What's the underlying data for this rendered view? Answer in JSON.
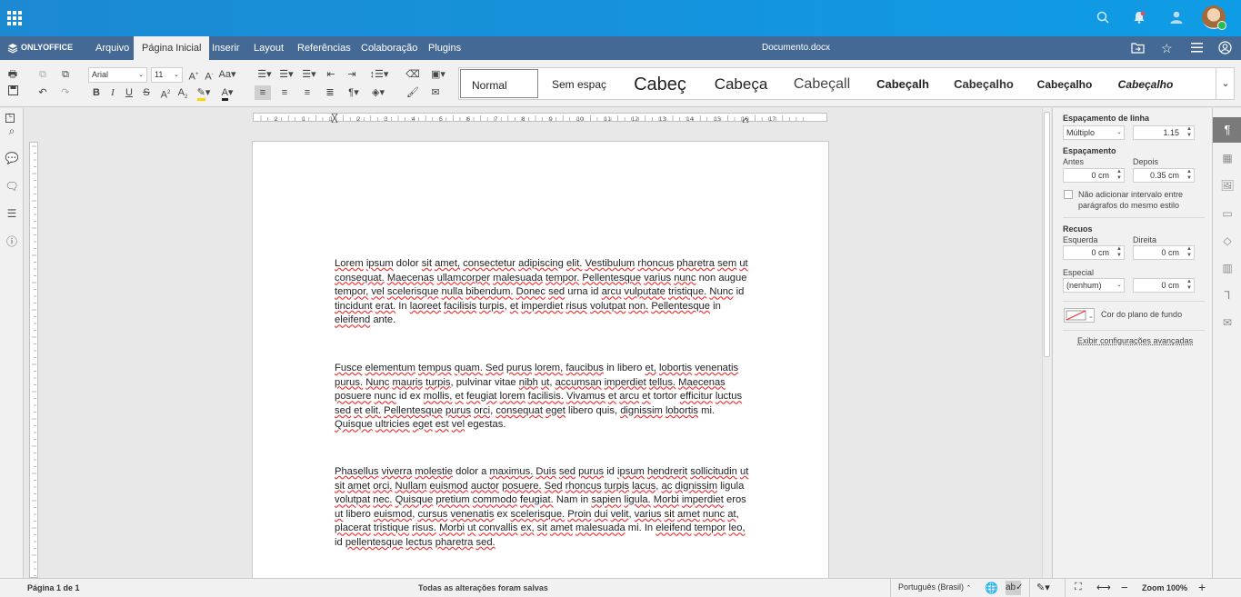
{
  "app": {
    "logo": "ONLYOFFICE",
    "doc_title": "Documento.docx"
  },
  "menu": {
    "items": [
      "Arquivo",
      "Página Inicial",
      "Inserir",
      "Layout",
      "Referências",
      "Colaboração",
      "Plugins"
    ]
  },
  "toolbar": {
    "font_name": "Arial",
    "font_size": "11",
    "styles": [
      "Normal",
      "Sem espaç",
      "Cabeç",
      "Cabeça",
      "Cabeçall",
      "Cabeçalh",
      "Cabeçalho",
      "Cabeçalho",
      "Cabeçalho"
    ]
  },
  "document": {
    "paragraphs": [
      "Lorem ipsum dolor sit amet, consectetur adipiscing elit. Vestibulum rhoncus pharetra sem ut consequat. Maecenas ullamcorper malesuada tempor. Pellentesque varius nunc non augue tempor, vel scelerisque nulla bibendum. Donec sed urna id arcu vulputate tristique. Nunc id tincidunt erat. In laoreet facilisis turpis, et imperdiet risus volutpat non. Pellentesque in eleifend ante.",
      "Fusce elementum tempus quam. Sed purus lorem, faucibus in libero et, lobortis venenatis purus. Nunc mauris turpis, pulvinar vitae nibh ut, accumsan imperdiet tellus. Maecenas posuere nunc id ex mollis, et feugiat lorem facilisis. Vivamus et arcu et tortor efficitur luctus sed et elit. Pellentesque purus orci, consequat eget libero quis, dignissim lobortis mi. Quisque ultricies eget est vel egestas.",
      "Phasellus viverra molestie dolor a maximus. Duis sed purus id ipsum hendrerit sollicitudin ut sit amet orci. Nullam euismod auctor posuere. Sed rhoncus turpis lacus, ac dignissim ligula volutpat nec. Quisque pretium commodo feugiat. Nam in sapien ligula. Morbi imperdiet eros ut libero euismod, cursus venenatis ex scelerisque. Proin dui velit, varius sit amet nunc at, placerat tristique risus. Morbi ut convallis ex, sit amet malesuada mi. In eleifend tempor leo, id pellentesque lectus pharetra sed."
    ]
  },
  "panel": {
    "line_spacing_label": "Espaçamento de linha",
    "line_spacing_mode": "Múltiplo",
    "line_spacing_value": "1.15",
    "spacing_label": "Espaçamento",
    "before_label": "Antes",
    "after_label": "Depois",
    "before_value": "0 cm",
    "after_value": "0.35 cm",
    "no_interval_label": "Não adicionar intervalo entre parágrafos do mesmo estilo",
    "indents_label": "Recuos",
    "left_label": "Esquerda",
    "right_label": "Direita",
    "left_value": "0 cm",
    "right_value": "0 cm",
    "special_label": "Especial",
    "special_value": "(nenhum)",
    "special_amount": "0 cm",
    "bg_color_label": "Cor do plano de fundo",
    "advanced_link": "Exibir configurações avançadas"
  },
  "ruler_numbers": [
    "2",
    "1",
    "1",
    "2",
    "3",
    "4",
    "5",
    "6",
    "7",
    "8",
    "9",
    "10",
    "11",
    "12",
    "13",
    "14",
    "15",
    "16",
    "17"
  ],
  "status": {
    "page": "Página 1 de 1",
    "saved": "Todas as alterações foram salvas",
    "language": "Português (Brasil)",
    "zoom": "Zoom 100%"
  },
  "colors": {
    "topbar": "#1a8cd8",
    "menubar": "#446995",
    "spell_underline": "#e33333"
  }
}
